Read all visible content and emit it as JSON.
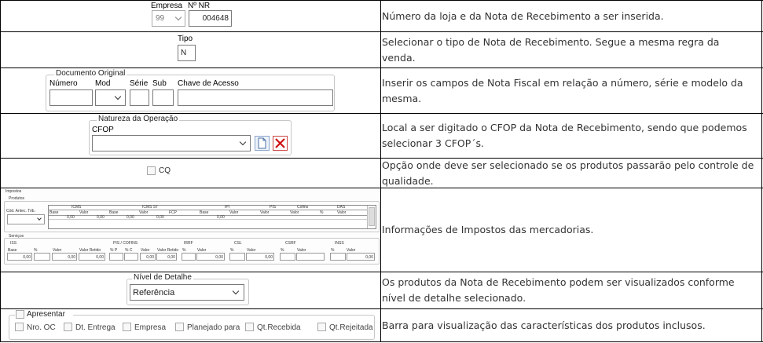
{
  "rows": [
    {
      "description": "Número da loja e da Nota de Recebimento a ser inserida.",
      "empresa": {
        "label": "Empresa",
        "value": "99"
      },
      "nr": {
        "label": "Nº NR",
        "value": "004648"
      }
    },
    {
      "description": "Selecionar o tipo de Nota de Recebimento. Segue a mesma regra da venda.",
      "tipo": {
        "label": "Tipo",
        "value": "N"
      }
    },
    {
      "description": "Inserir os campos de Nota Fiscal em relação a número, série e modelo da mesma.",
      "group_title": "Documento Original",
      "labels": {
        "numero": "Número",
        "mod": "Mod",
        "serie": "Série",
        "sub": "Sub",
        "chave": "Chave de Acesso"
      }
    },
    {
      "description": "Local a ser digitado o CFOP da Nota de Recebimento, sendo que podemos selecionar 3 CFOP´s.",
      "group_title": "Natureza da Operação",
      "cfop_label": "CFOP"
    },
    {
      "description": "Opção onde deve ser selecionado se os produtos passarão pelo controle de qualidade.",
      "cq_label": "CQ"
    },
    {
      "description": "Informações de Impostos das mercadorias.",
      "impostos": {
        "title": "Impostos",
        "produtos": "Produtos",
        "cod_antec": "Cód. Antec. Trib.",
        "groups": [
          "ICMS",
          "ICMS ST",
          "IPI",
          "PIS",
          "Cofins",
          "DAS"
        ],
        "cols": [
          "Base",
          "Valor",
          "Base",
          "Valor",
          "FCP",
          "Base",
          "Valor",
          "Valor",
          "Valor",
          "%",
          "Valor"
        ],
        "vals": [
          "0,00",
          "0,00",
          "0,00",
          "0,00",
          "0,00"
        ],
        "servicos": "Serviços",
        "svc_groups": [
          "ISS",
          "PIS / COFINS",
          "IRRF",
          "CSL",
          "CSRF",
          "INSS"
        ],
        "svc_cols": [
          "Base",
          "%",
          "Valor",
          "Valor Retido",
          "% P",
          "% C",
          "Valor",
          "Valor Retido",
          "%",
          "Valor",
          "%",
          "Valor",
          "%",
          "Valor",
          "%",
          "Valor"
        ],
        "svc_vals": [
          "0,00",
          "0,00",
          "0,00",
          "0,00",
          "0,00",
          "0,00",
          "0,00",
          "0,00"
        ]
      }
    },
    {
      "description": "Os produtos da Nota de Recebimento podem ser visualizados conforme nível de detalhe selecionado.",
      "group_title": "Nível de Detalhe",
      "value": "Referência"
    },
    {
      "description": "Barra para visualização das características dos produtos inclusos.",
      "apresentar": "Apresentar",
      "options": [
        "Nro. OC",
        "Dt. Entrega",
        "Empresa",
        "Planejado para",
        "Qt.Recebida",
        "Qt.Rejeitada"
      ]
    }
  ]
}
